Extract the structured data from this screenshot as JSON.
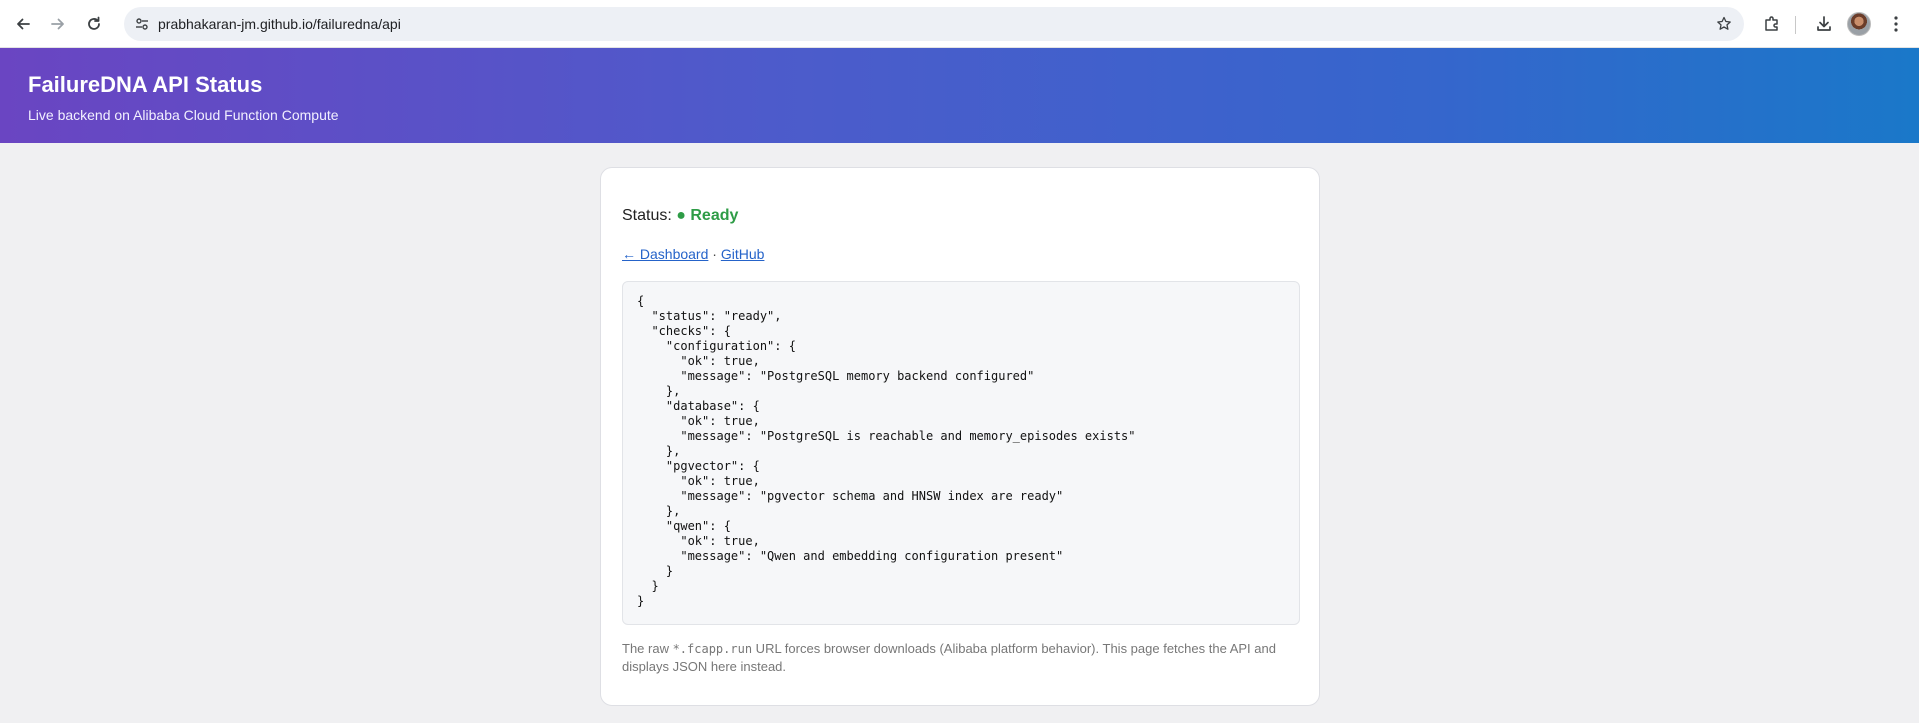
{
  "browser": {
    "url": "prabhakaran-jm.github.io/failuredna/api",
    "icons": [
      "back-arrow-icon",
      "forward-arrow-icon",
      "reload-icon",
      "site-info-icon",
      "star-icon",
      "extensions-icon",
      "download-icon",
      "avatar",
      "more-menu-icon"
    ]
  },
  "header": {
    "title": "FailureDNA API Status",
    "subtitle": "Live backend on Alibaba Cloud Function Compute",
    "gradient_colors": [
      "#6a45c2",
      "#1a78c9"
    ]
  },
  "status": {
    "label": "Status:",
    "value": "● Ready",
    "value_color": "#2e9c46"
  },
  "links": {
    "dashboard": "← Dashboard",
    "separator": "·",
    "github": "GitHub"
  },
  "json_output": "{\n  \"status\": \"ready\",\n  \"checks\": {\n    \"configuration\": {\n      \"ok\": true,\n      \"message\": \"PostgreSQL memory backend configured\"\n    },\n    \"database\": {\n      \"ok\": true,\n      \"message\": \"PostgreSQL is reachable and memory_episodes exists\"\n    },\n    \"pgvector\": {\n      \"ok\": true,\n      \"message\": \"pgvector schema and HNSW index are ready\"\n    },\n    \"qwen\": {\n      \"ok\": true,\n      \"message\": \"Qwen and embedding configuration present\"\n    }\n  }\n}",
  "footnote": {
    "prefix": "The raw ",
    "code": "*.fcapp.run",
    "suffix": " URL forces browser downloads (Alibaba platform behavior). This page fetches the API and displays JSON here instead."
  }
}
